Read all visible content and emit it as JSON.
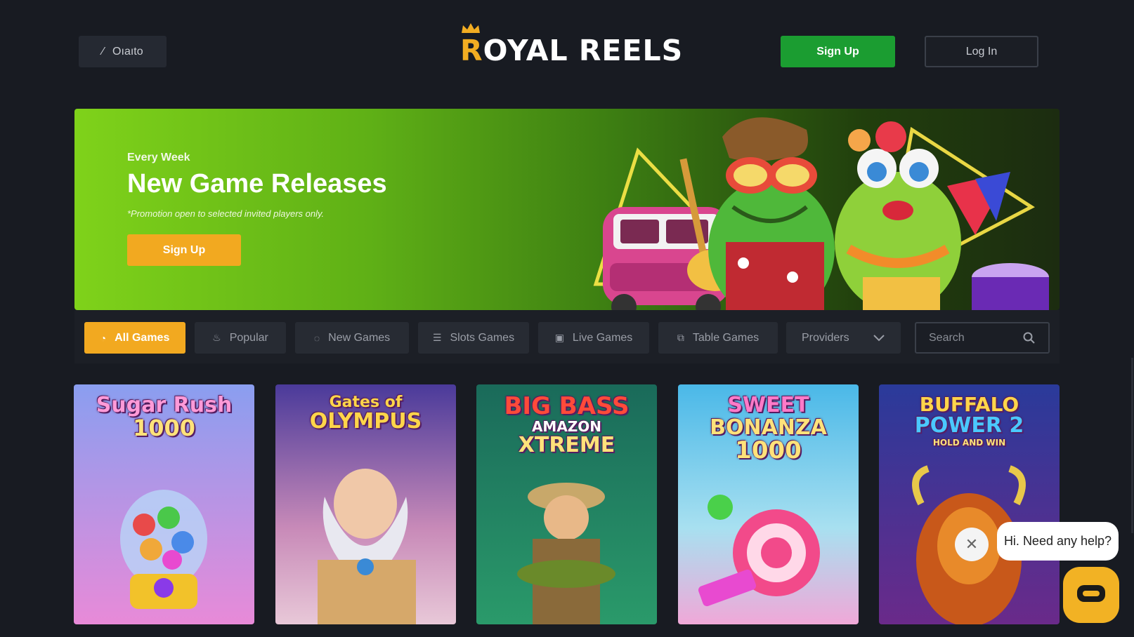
{
  "header": {
    "menu_label": "Oıaıto",
    "menu_icon": "wand-icon",
    "logo_first_letter": "R",
    "logo_rest": "OYAL REELS",
    "signup_label": "Sign Up",
    "login_label": "Log In"
  },
  "banner": {
    "eyebrow": "Every Week",
    "title": "New Game Releases",
    "note": "*Promotion open to selected invited players only.",
    "cta_label": "Sign Up"
  },
  "categories": [
    {
      "label": "All Games",
      "icon": "all-games-icon",
      "active": true
    },
    {
      "label": "Popular",
      "icon": "flame-icon",
      "active": false
    },
    {
      "label": "New Games",
      "icon": "bell-icon",
      "active": false
    },
    {
      "label": "Slots Games",
      "icon": "slots-icon",
      "active": false
    },
    {
      "label": "Live Games",
      "icon": "live-icon",
      "active": false
    },
    {
      "label": "Table Games",
      "icon": "table-icon",
      "active": false
    },
    {
      "label": "Providers",
      "icon": "chevron-down-icon",
      "active": false
    }
  ],
  "search": {
    "placeholder": "Search"
  },
  "games": [
    {
      "title_line1": "Sugar Rush",
      "title_line2": "1000",
      "title_line3": ""
    },
    {
      "title_line1": "Gates of",
      "title_line2": "OLYMPUS",
      "title_line3": ""
    },
    {
      "title_line1": "BIG BASS",
      "title_line2": "AMAZON",
      "title_line3": "XTREME"
    },
    {
      "title_line1": "SWEET",
      "title_line2": "BONANZA",
      "title_line3": "1000"
    },
    {
      "title_line1": "BUFFALO",
      "title_line2": "POWER 2",
      "title_line3": "HOLD AND WIN"
    }
  ],
  "chat": {
    "message": "Hi. Need any help?"
  },
  "colors": {
    "accent_orange": "#f2a920",
    "signup_green": "#1b9d31",
    "background": "#181b22"
  }
}
